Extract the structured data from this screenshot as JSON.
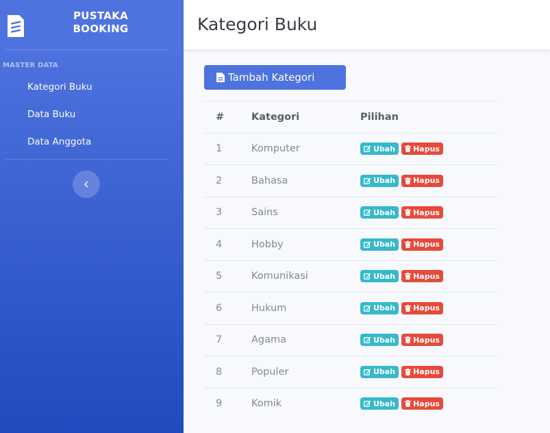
{
  "sidebar": {
    "brand_line1": "PUSTAKA",
    "brand_line2": "BOOKING",
    "heading": "MASTER DATA",
    "items": [
      {
        "label": "Kategori Buku"
      },
      {
        "label": "Data Buku"
      },
      {
        "label": "Data Anggota"
      }
    ],
    "toggle_icon": "chevron-left-icon"
  },
  "topbar": {
    "title": "Kategori Buku"
  },
  "main": {
    "add_button_label": "Tambah Kategori",
    "table": {
      "headers": [
        "#",
        "Kategori",
        "Pilihan"
      ],
      "rows": [
        {
          "no": "1",
          "kategori": "Komputer"
        },
        {
          "no": "2",
          "kategori": "Bahasa"
        },
        {
          "no": "3",
          "kategori": "Sains"
        },
        {
          "no": "4",
          "kategori": "Hobby"
        },
        {
          "no": "5",
          "kategori": "Komunikasi"
        },
        {
          "no": "6",
          "kategori": "Hukum"
        },
        {
          "no": "7",
          "kategori": "Agama"
        },
        {
          "no": "8",
          "kategori": "Populer"
        },
        {
          "no": "9",
          "kategori": "Komik"
        }
      ],
      "edit_label": "Ubah",
      "delete_label": "Hapus"
    }
  },
  "colors": {
    "primary": "#4e73df",
    "info": "#36b9cc",
    "danger": "#e74a3b"
  }
}
